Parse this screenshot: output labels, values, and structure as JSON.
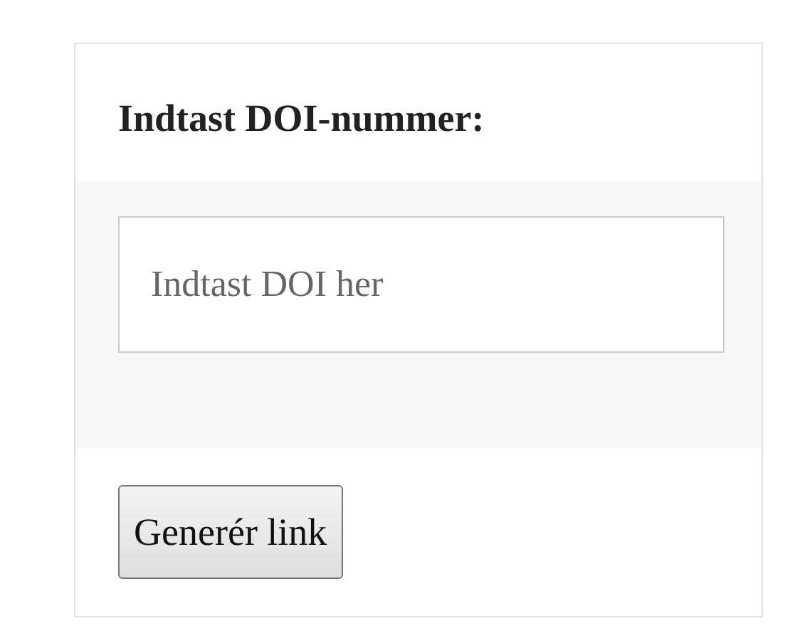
{
  "heading": "Indtast DOI-nummer:",
  "doi_field": {
    "placeholder": "Indtast DOI her"
  },
  "button": "Generér link"
}
